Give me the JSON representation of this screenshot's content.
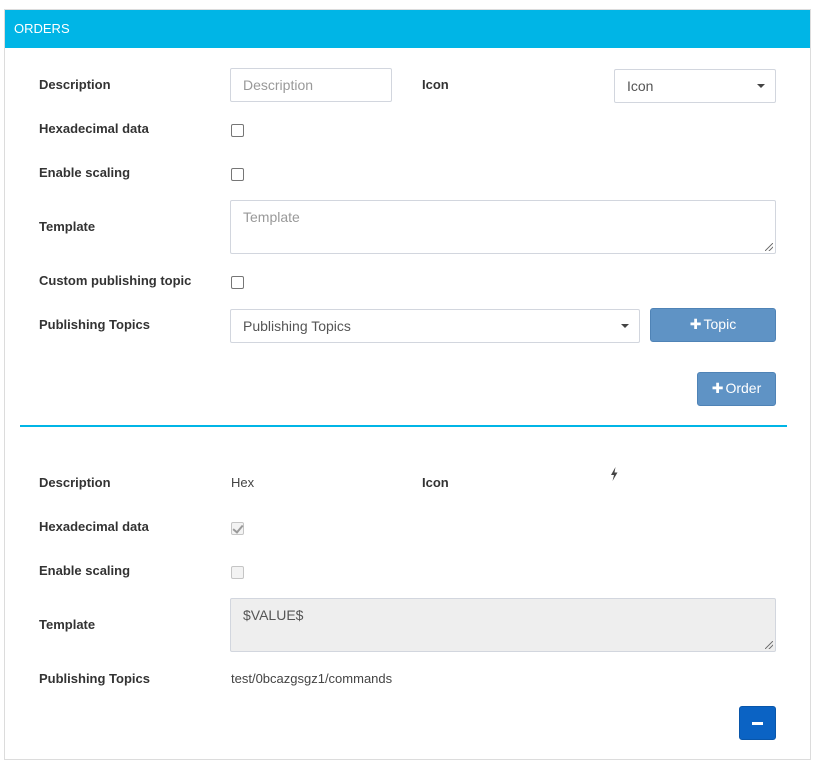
{
  "header": {
    "title": "ORDERS"
  },
  "form": {
    "description_label": "Description",
    "description_placeholder": "Description",
    "icon_label": "Icon",
    "icon_placeholder": "Icon",
    "hex_label": "Hexadecimal data",
    "scaling_label": "Enable scaling",
    "template_label": "Template",
    "template_placeholder": "Template",
    "custom_topic_label": "Custom publishing topic",
    "topics_label": "Publishing Topics",
    "topics_placeholder": "Publishing Topics",
    "add_topic_label": "Topic",
    "add_order_label": "Order"
  },
  "order": {
    "description_label": "Description",
    "description_value": "Hex",
    "icon_label": "Icon",
    "icon_name": "bolt-icon",
    "hex_label": "Hexadecimal data",
    "hex_checked": true,
    "scaling_label": "Enable scaling",
    "scaling_checked": false,
    "template_label": "Template",
    "template_value": "$VALUE$",
    "topics_label": "Publishing Topics",
    "topics_value": "test/0bcazgsgz1/commands"
  },
  "colors": {
    "header": "#00b5e6",
    "button": "#5f93c5",
    "remove_button": "#0b63c4",
    "divider": "#00b5e6"
  }
}
